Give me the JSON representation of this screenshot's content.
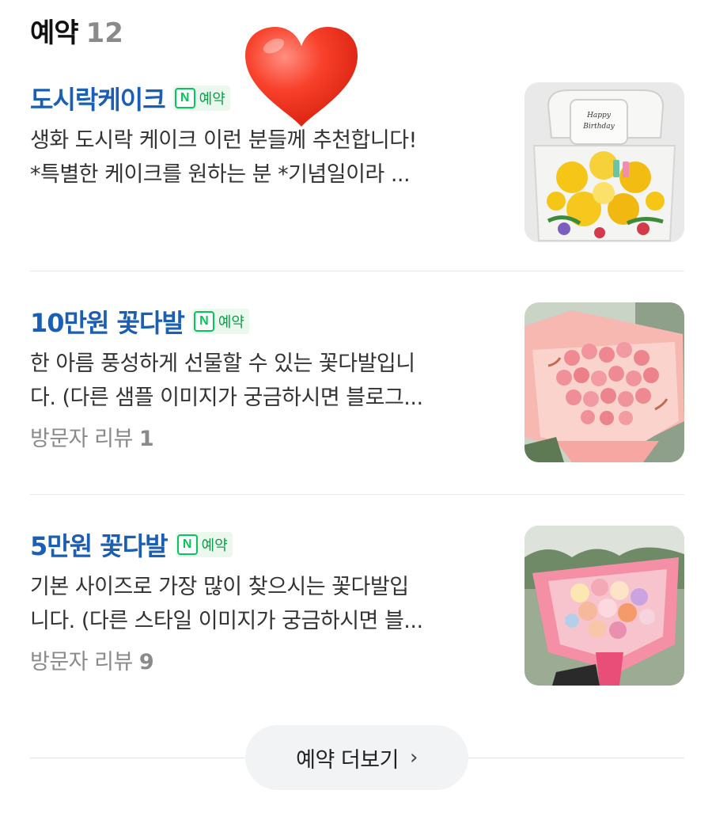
{
  "section": {
    "title": "예약",
    "count": "12"
  },
  "items": [
    {
      "name": "도시락케이크",
      "badge": {
        "icon": "N",
        "label": "예약"
      },
      "desc_lines": [
        "생화 도시락 케이크 이런 분들께 추천합니다!",
        "*특별한 케이크를 원하는 분 *기념일이라 ..."
      ],
      "review": null,
      "thumb_text": "Happy Birthday"
    },
    {
      "name": "10만원 꽃다발",
      "badge": {
        "icon": "N",
        "label": "예약"
      },
      "desc_lines": [
        "한 아름 풍성하게 선물할 수 있는 꽃다발입니",
        "다. (다른 샘플 이미지가 궁금하시면 블로그..."
      ],
      "review": {
        "label": "방문자 리뷰",
        "count": "1"
      }
    },
    {
      "name": "5만원 꽃다발",
      "badge": {
        "icon": "N",
        "label": "예약"
      },
      "desc_lines": [
        "기본 사이즈로 가장 많이 찾으시는 꽃다발입",
        "니다. (다른 스타일 이미지가 궁금하시면 블..."
      ],
      "review": {
        "label": "방문자 리뷰",
        "count": "9"
      }
    }
  ],
  "more": {
    "label": "예약 더보기",
    "icon": "chevron-right-icon"
  },
  "colors": {
    "accent": "#1a5fb4",
    "naver_green": "#03c75a",
    "muted": "#8a8a8a"
  }
}
